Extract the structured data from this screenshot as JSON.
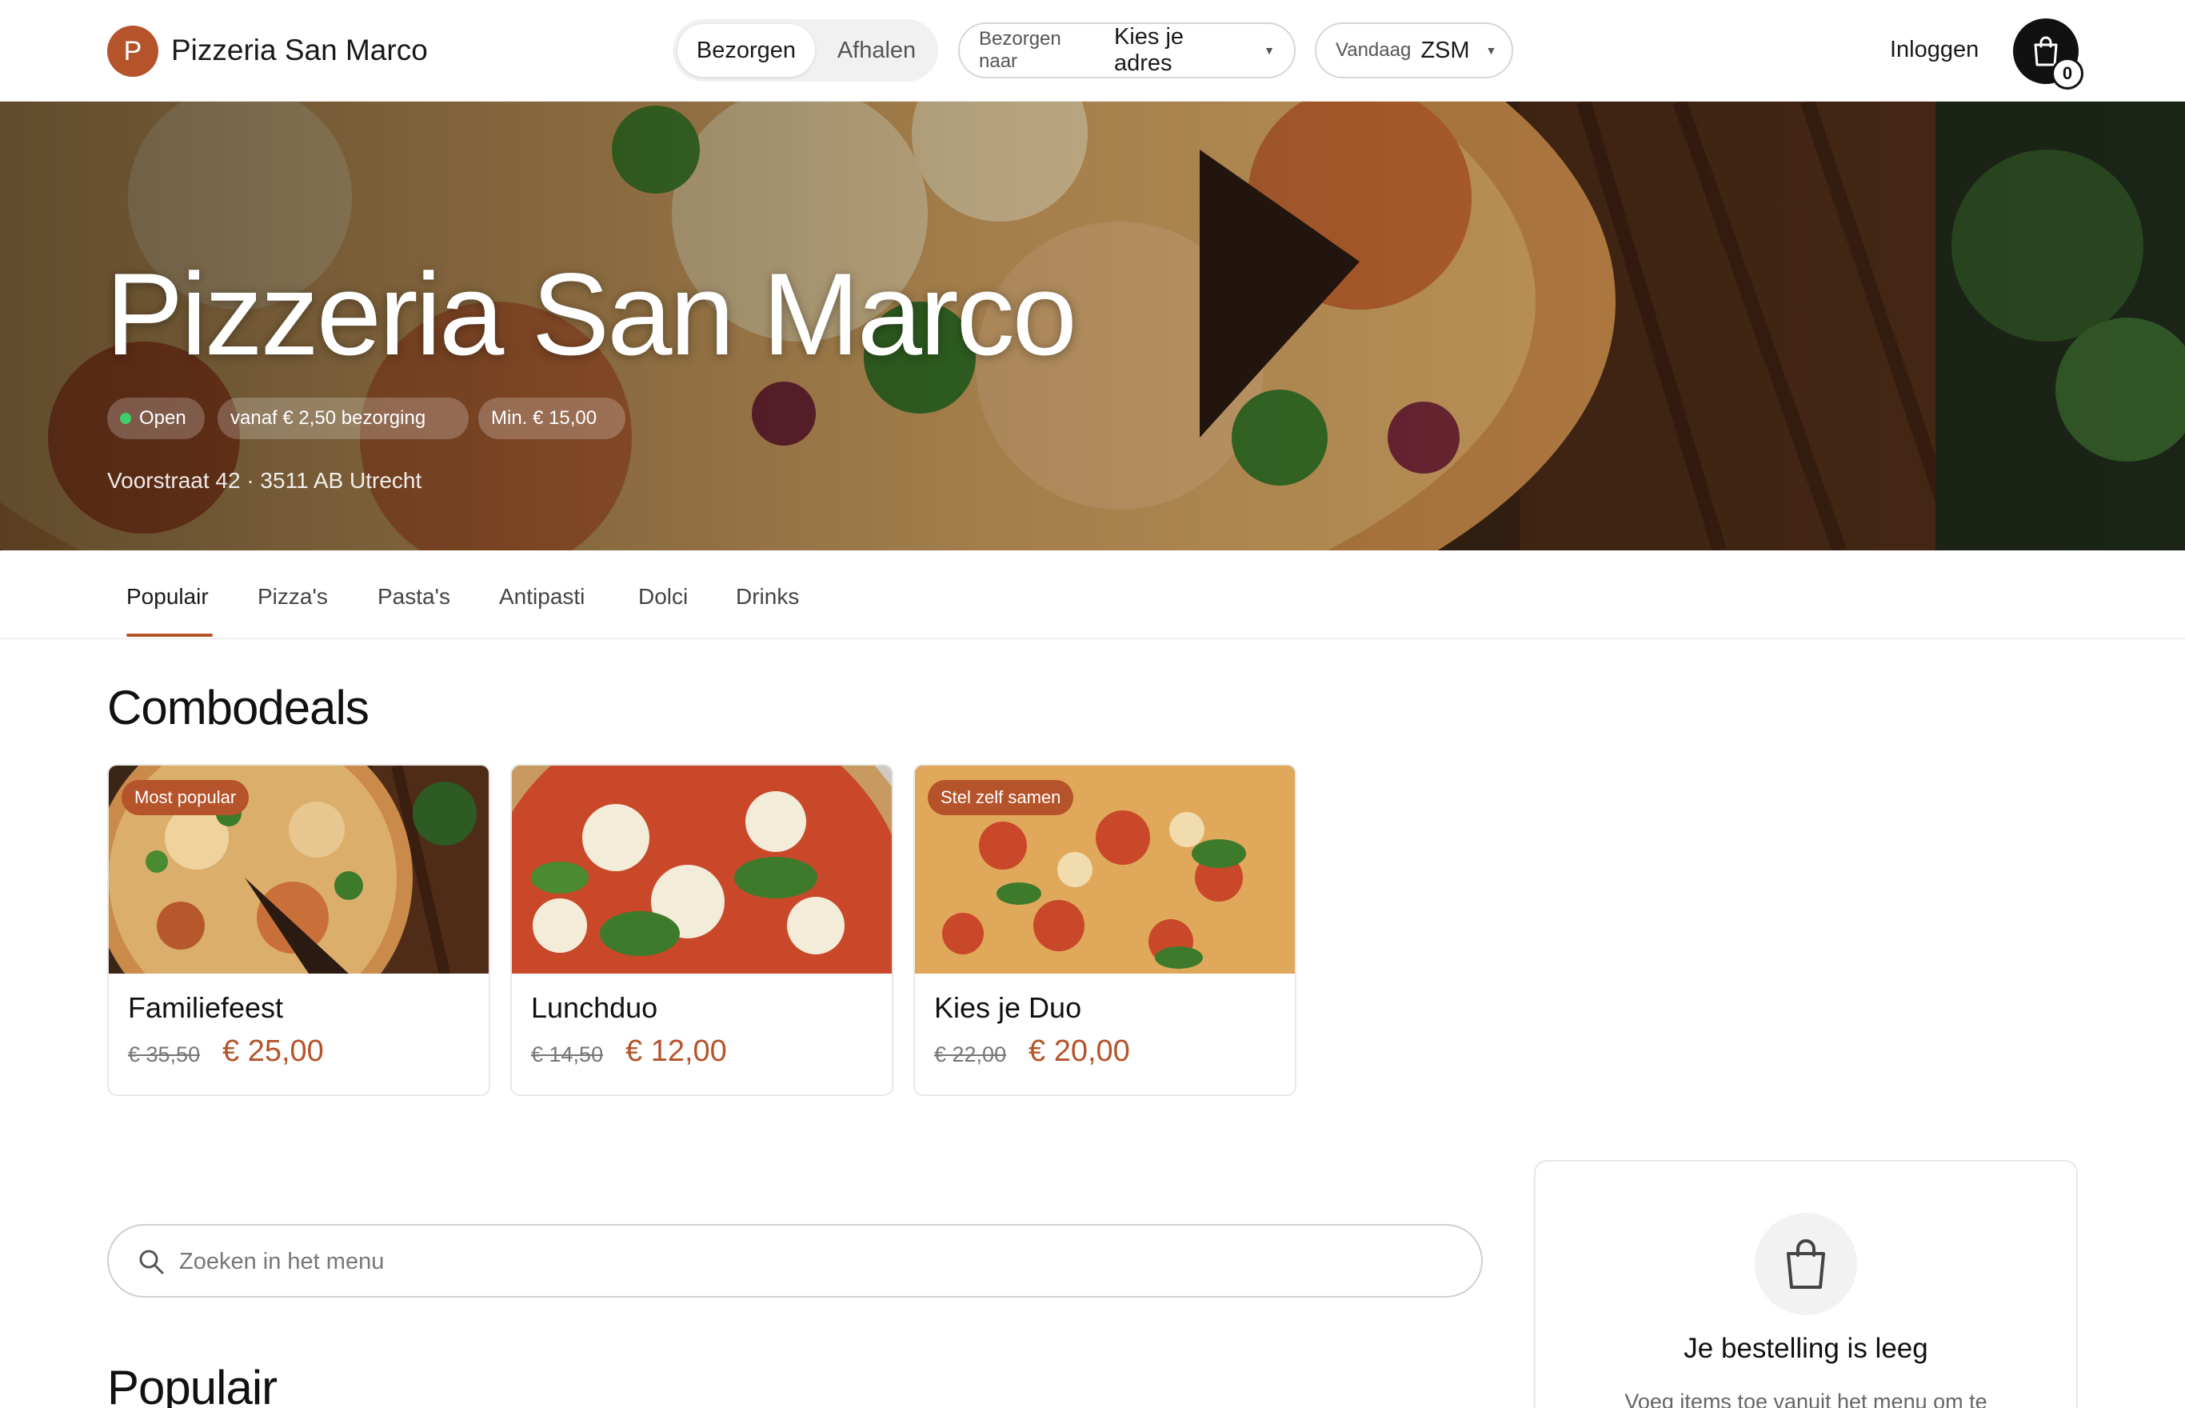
{
  "header": {
    "logo_letter": "P",
    "brand_name": "Pizzeria San Marco",
    "mode_delivery": "Bezorgen",
    "mode_pickup": "Afhalen",
    "address_prefix": "Bezorgen naar",
    "address_value": "Kies je adres",
    "time_prefix": "Vandaag",
    "time_value": "ZSM",
    "login_label": "Inloggen",
    "cart_count": "0"
  },
  "hero": {
    "title": "Pizzeria San Marco",
    "status_chip": "Open",
    "delivery_chip": "vanaf € 2,50 bezorging",
    "minimum_chip": "Min. € 15,00",
    "address": "Voorstraat 42 · 3511 AB Utrecht"
  },
  "tabs": [
    "Populair",
    "Pizza's",
    "Pasta's",
    "Antipasti",
    "Dolci",
    "Drinks"
  ],
  "combodeals": {
    "title": "Combodeals",
    "deals": [
      {
        "badge": "Most popular",
        "name": "Familiefeest",
        "old_price": "€ 35,50",
        "price": "€ 25,00"
      },
      {
        "badge": "",
        "name": "Lunchduo",
        "old_price": "€ 14,50",
        "price": "€ 12,00"
      },
      {
        "badge": "Stel zelf samen",
        "name": "Kies je Duo",
        "old_price": "€ 22,00",
        "price": "€ 20,00"
      }
    ]
  },
  "search": {
    "placeholder": "Zoeken in het menu"
  },
  "popular_title": "Populair",
  "order": {
    "empty_title": "Je bestelling is leeg",
    "empty_text": "Voeg items toe vanuit het menu om te"
  },
  "colors": {
    "accent": "#b5532a",
    "open_dot": "#3fcf6a",
    "cart_button": "#111111"
  }
}
